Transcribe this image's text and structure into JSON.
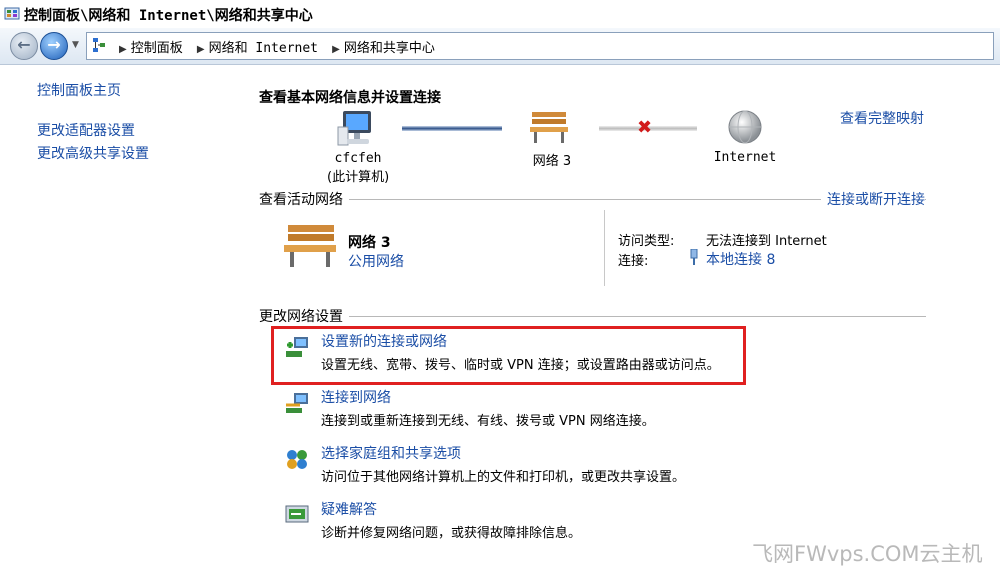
{
  "window": {
    "title": "控制面板\\网络和 Internet\\网络和共享中心"
  },
  "address_bar": {
    "crumbs": [
      "控制面板",
      "网络和 Internet",
      "网络和共享中心"
    ]
  },
  "left_pane": {
    "links": [
      "控制面板主页",
      "更改适配器设置",
      "更改高级共享设置"
    ]
  },
  "main": {
    "heading": "查看基本网络信息并设置连接",
    "full_map_link": "查看完整映射",
    "map": {
      "computer": {
        "name": "cfcfeh",
        "subtitle": "(此计算机)"
      },
      "network": {
        "name": "网络  3"
      },
      "internet": {
        "name": "Internet"
      }
    },
    "active_networks": {
      "title": "查看活动网络",
      "action_link": "连接或断开连接",
      "network_name": "网络  3",
      "network_category": "公用网络",
      "access_type_label": "访问类型:",
      "access_type_value": "无法连接到 Internet",
      "connections_label": "连接:",
      "connections_value": "本地连接 8"
    },
    "change_settings": {
      "title": "更改网络设置",
      "tasks": [
        {
          "link": "设置新的连接或网络",
          "desc": "设置无线、宽带、拨号、临时或 VPN 连接；或设置路由器或访问点。"
        },
        {
          "link": "连接到网络",
          "desc": "连接到或重新连接到无线、有线、拨号或 VPN 网络连接。"
        },
        {
          "link": "选择家庭组和共享选项",
          "desc": "访问位于其他网络计算机上的文件和打印机，或更改共享设置。"
        },
        {
          "link": "疑难解答",
          "desc": "诊断并修复网络问题，或获得故障排除信息。"
        }
      ]
    }
  },
  "watermark": "飞网FWvps.COM云主机",
  "colors": {
    "link": "#1b4ea6",
    "highlight_box": "#e02020"
  }
}
